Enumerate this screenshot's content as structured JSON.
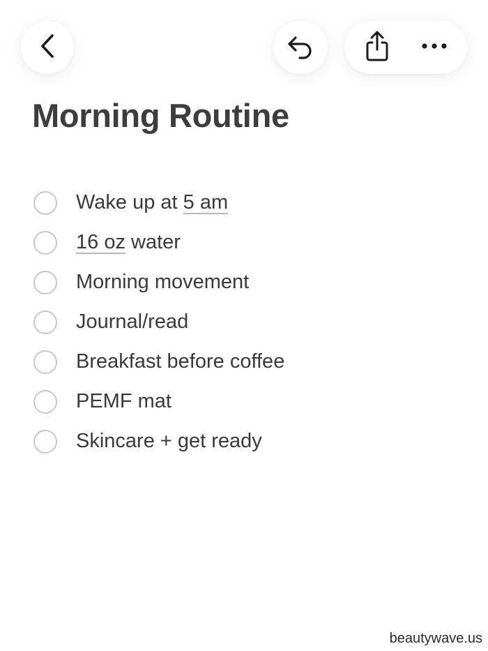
{
  "toolbar": {
    "back_icon": "chevron-left-icon",
    "undo_icon": "undo-arrow-icon",
    "share_icon": "share-icon",
    "more_icon": "more-horizontal-icon"
  },
  "note": {
    "title": "Morning Routine",
    "items": [
      {
        "before": "Wake up at ",
        "link": "5 am",
        "after": "",
        "checked": false
      },
      {
        "before": "",
        "link": "16 oz",
        "after": " water",
        "checked": false
      },
      {
        "before": "Morning movement",
        "link": "",
        "after": "",
        "checked": false
      },
      {
        "before": "Journal/read",
        "link": "",
        "after": "",
        "checked": false
      },
      {
        "before": "Breakfast before coffee",
        "link": "",
        "after": "",
        "checked": false
      },
      {
        "before": "PEMF mat",
        "link": "",
        "after": "",
        "checked": false
      },
      {
        "before": "Skincare + get ready",
        "link": "",
        "after": "",
        "checked": false
      }
    ]
  },
  "watermark": "beautywave.us",
  "colors": {
    "text": "#3a3a3c",
    "checkbox_border": "#c8c8cc",
    "link_underline": "#b8b8bc"
  }
}
